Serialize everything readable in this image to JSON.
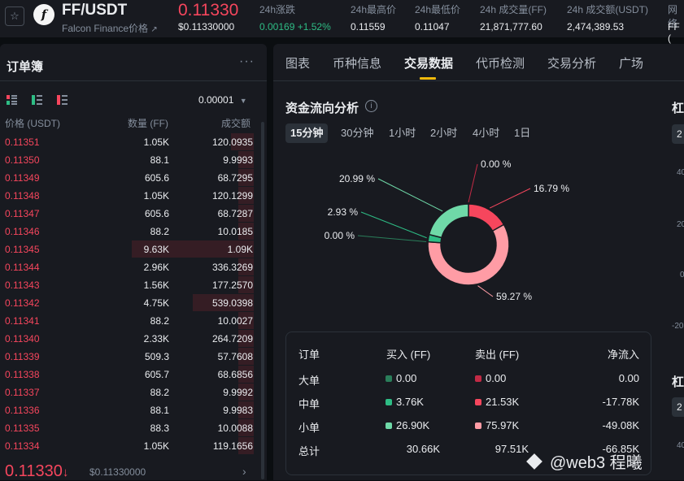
{
  "header": {
    "star_icon": "star-icon",
    "logo_letter": "f",
    "pair": "FF/USDT",
    "project_name": "Falcon Finance价格",
    "external_icon": "↗",
    "last_price": "0.11330",
    "last_price_usd": "$0.11330000",
    "change_label": "24h涨跌",
    "change_value": "0.00169",
    "change_pct": "+1.52%",
    "high_label": "24h最高价",
    "high_value": "0.11559",
    "low_label": "24h最低价",
    "low_value": "0.11047",
    "vol_ff_label": "24h 成交量(FF)",
    "vol_ff_value": "21,871,777.60",
    "vol_usdt_label": "24h 成交额(USDT)",
    "vol_usdt_value": "2,474,389.53",
    "network_label": "网络",
    "network_value": "FF ("
  },
  "orderbook": {
    "title": "订单簿",
    "more_icon": "···",
    "tick_size": "0.00001",
    "col_price": "价格 (USDT)",
    "col_qty": "数量 (FF)",
    "col_total": "成交额",
    "rows": [
      {
        "price": "0.11351",
        "qty": "1.05K",
        "total": "120.0935",
        "depth": 0.09
      },
      {
        "price": "0.11350",
        "qty": "88.1",
        "total": "9.9993",
        "depth": 0.06
      },
      {
        "price": "0.11349",
        "qty": "605.6",
        "total": "68.7295",
        "depth": 0.06
      },
      {
        "price": "0.11348",
        "qty": "1.05K",
        "total": "120.1299",
        "depth": 0.06
      },
      {
        "price": "0.11347",
        "qty": "605.6",
        "total": "68.7287",
        "depth": 0.06
      },
      {
        "price": "0.11346",
        "qty": "88.2",
        "total": "10.0185",
        "depth": 0.06
      },
      {
        "price": "0.11345",
        "qty": "9.63K",
        "total": "1.09K",
        "depth": 0.48
      },
      {
        "price": "0.11344",
        "qty": "2.96K",
        "total": "336.3269",
        "depth": 0.06
      },
      {
        "price": "0.11343",
        "qty": "1.56K",
        "total": "177.2570",
        "depth": 0.06
      },
      {
        "price": "0.11342",
        "qty": "4.75K",
        "total": "539.0398",
        "depth": 0.24
      },
      {
        "price": "0.11341",
        "qty": "88.2",
        "total": "10.0027",
        "depth": 0.06
      },
      {
        "price": "0.11340",
        "qty": "2.33K",
        "total": "264.7209",
        "depth": 0.06
      },
      {
        "price": "0.11339",
        "qty": "509.3",
        "total": "57.7608",
        "depth": 0.06
      },
      {
        "price": "0.11338",
        "qty": "605.7",
        "total": "68.6856",
        "depth": 0.06
      },
      {
        "price": "0.11337",
        "qty": "88.2",
        "total": "9.9992",
        "depth": 0.06
      },
      {
        "price": "0.11336",
        "qty": "88.1",
        "total": "9.9983",
        "depth": 0.06
      },
      {
        "price": "0.11335",
        "qty": "88.3",
        "total": "10.0088",
        "depth": 0.06
      },
      {
        "price": "0.11334",
        "qty": "1.05K",
        "total": "119.1656",
        "depth": 0.06
      }
    ],
    "bottom_price": "0.11330",
    "bottom_arrow": "↓",
    "bottom_usd": "$0.11330000",
    "chevron": "›"
  },
  "panel": {
    "tabs": [
      "图表",
      "币种信息",
      "交易数据",
      "代币检测",
      "交易分析",
      "广场"
    ],
    "active_tab": 2,
    "capital_flow_title": "资金流向分析",
    "info_icon": "i",
    "intervals": [
      "15分钟",
      "30分钟",
      "1小时",
      "2小时",
      "4小时",
      "1日"
    ],
    "active_interval": 0,
    "table": {
      "headers": [
        "订单",
        "买入 (FF)",
        "卖出 (FF)",
        "净流入"
      ],
      "rows": [
        {
          "label": "大单",
          "buy": "0.00",
          "sell": "0.00",
          "net": "0.00"
        },
        {
          "label": "中单",
          "buy": "3.76K",
          "sell": "21.53K",
          "net": "-17.78K"
        },
        {
          "label": "小单",
          "buy": "26.90K",
          "sell": "75.97K",
          "net": "-49.08K"
        },
        {
          "label": "总计",
          "buy": "30.66K",
          "sell": "97.51K",
          "net": "-66.85K"
        }
      ]
    },
    "colors": {
      "large_buy": "#2a7e5a",
      "medium_buy": "#2ebd85",
      "small_buy": "#6fd9a8",
      "large_sell": "#c22a45",
      "medium_sell": "#f6465d",
      "small_sell": "#ff9ca5"
    }
  },
  "chart_data": {
    "type": "pie",
    "labels": [
      "0.00 %",
      "16.79 %",
      "59.27 %",
      "0.00 %",
      "2.93 %",
      "20.99 %"
    ],
    "values": [
      0.0,
      16.79,
      59.27,
      0.0,
      2.93,
      20.99
    ],
    "colors": [
      "#c22a45",
      "#f6465d",
      "#ff9ca5",
      "#2a7e5a",
      "#2ebd85",
      "#6fd9a8"
    ]
  },
  "right_column": {
    "label1": "杠",
    "box1": "2",
    "axis": [
      "40",
      "20",
      "0",
      "-20"
    ],
    "label2": "杠",
    "box2": "2",
    "axis2": "40"
  },
  "watermark": "@web3  程曦"
}
